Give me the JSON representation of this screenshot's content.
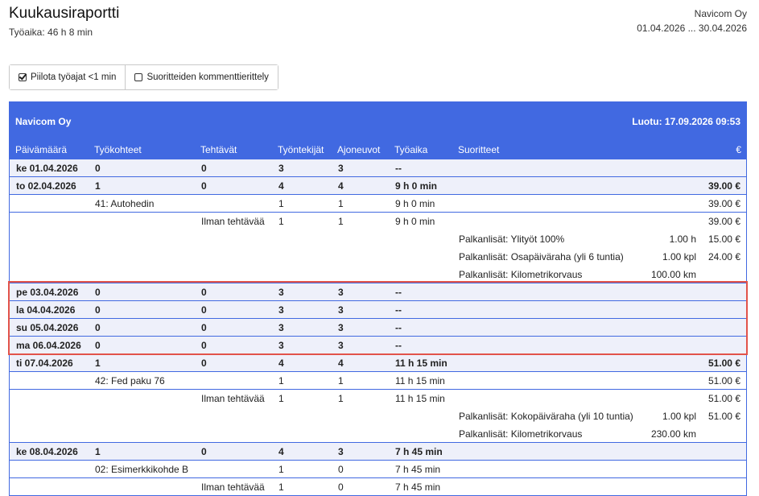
{
  "header": {
    "title": "Kuukausiraportti",
    "subtitle": "Työaika: 46 h 8 min",
    "company": "Navicom Oy",
    "date_range": "01.04.2026 ... 30.04.2026"
  },
  "toolbar": {
    "hide_short_label": "Piilota työajat <1 min",
    "hide_short_checked": true,
    "comment_rows_label": "Suoritteiden kommenttierittely",
    "comment_rows_checked": false
  },
  "report": {
    "company": "Navicom Oy",
    "created": "Luotu: 17.09.2026 09:53",
    "columns": [
      "Päivämäärä",
      "Työkohteet",
      "Tehtävät",
      "Työntekijät",
      "Ajoneuvot",
      "Työaika",
      "Suoritteet",
      "€"
    ],
    "rows": [
      {
        "kind": "day",
        "date": "ke 01.04.2026",
        "sites": "0",
        "tasks": "0",
        "employees": "3",
        "vehicles": "3",
        "time": "--",
        "perf": "",
        "qty": "",
        "eur": ""
      },
      {
        "kind": "day",
        "date": "to 02.04.2026",
        "sites": "1",
        "tasks": "0",
        "employees": "4",
        "vehicles": "4",
        "time": "9 h 0 min",
        "perf": "",
        "qty": "",
        "eur": "39.00 €"
      },
      {
        "kind": "sub",
        "date": "",
        "sites": "41: Autohedin",
        "tasks": "",
        "employees": "1",
        "vehicles": "1",
        "time": "9 h 0 min",
        "perf": "",
        "qty": "",
        "eur": "39.00 €"
      },
      {
        "kind": "sub",
        "date": "",
        "sites": "",
        "tasks": "Ilman tehtävää",
        "employees": "1",
        "vehicles": "1",
        "time": "9 h 0 min",
        "perf": "",
        "qty": "",
        "eur": "39.00 €",
        "noborder": true
      },
      {
        "kind": "sub",
        "date": "",
        "sites": "",
        "tasks": "",
        "employees": "",
        "vehicles": "",
        "time": "",
        "perf": "Palkanlisät: Ylityöt 100%",
        "qty": "1.00 h",
        "eur": "15.00 €",
        "noborder": true
      },
      {
        "kind": "sub",
        "date": "",
        "sites": "",
        "tasks": "",
        "employees": "",
        "vehicles": "",
        "time": "",
        "perf": "Palkanlisät: Osapäiväraha (yli 6 tuntia)",
        "qty": "1.00 kpl",
        "eur": "24.00 €",
        "noborder": true
      },
      {
        "kind": "sub",
        "date": "",
        "sites": "",
        "tasks": "",
        "employees": "",
        "vehicles": "",
        "time": "",
        "perf": "Palkanlisät: Kilometrikorvaus",
        "qty": "100.00 km",
        "eur": ""
      },
      {
        "kind": "day",
        "date": "pe 03.04.2026",
        "sites": "0",
        "tasks": "0",
        "employees": "3",
        "vehicles": "3",
        "time": "--",
        "perf": "",
        "qty": "",
        "eur": ""
      },
      {
        "kind": "day",
        "date": "la 04.04.2026",
        "sites": "0",
        "tasks": "0",
        "employees": "3",
        "vehicles": "3",
        "time": "--",
        "perf": "",
        "qty": "",
        "eur": ""
      },
      {
        "kind": "day",
        "date": "su 05.04.2026",
        "sites": "0",
        "tasks": "0",
        "employees": "3",
        "vehicles": "3",
        "time": "--",
        "perf": "",
        "qty": "",
        "eur": ""
      },
      {
        "kind": "day",
        "date": "ma 06.04.2026",
        "sites": "0",
        "tasks": "0",
        "employees": "3",
        "vehicles": "3",
        "time": "--",
        "perf": "",
        "qty": "",
        "eur": ""
      },
      {
        "kind": "day",
        "date": "ti 07.04.2026",
        "sites": "1",
        "tasks": "0",
        "employees": "4",
        "vehicles": "4",
        "time": "11 h 15 min",
        "perf": "",
        "qty": "",
        "eur": "51.00 €"
      },
      {
        "kind": "sub",
        "date": "",
        "sites": "42: Fed paku 76",
        "tasks": "",
        "employees": "1",
        "vehicles": "1",
        "time": "11 h 15 min",
        "perf": "",
        "qty": "",
        "eur": "51.00 €"
      },
      {
        "kind": "sub",
        "date": "",
        "sites": "",
        "tasks": "Ilman tehtävää",
        "employees": "1",
        "vehicles": "1",
        "time": "11 h 15 min",
        "perf": "",
        "qty": "",
        "eur": "51.00 €",
        "noborder": true
      },
      {
        "kind": "sub",
        "date": "",
        "sites": "",
        "tasks": "",
        "employees": "",
        "vehicles": "",
        "time": "",
        "perf": "Palkanlisät: Kokopäiväraha (yli 10 tuntia)",
        "qty": "1.00 kpl",
        "eur": "51.00 €",
        "noborder": true
      },
      {
        "kind": "sub",
        "date": "",
        "sites": "",
        "tasks": "",
        "employees": "",
        "vehicles": "",
        "time": "",
        "perf": "Palkanlisät: Kilometrikorvaus",
        "qty": "230.00 km",
        "eur": ""
      },
      {
        "kind": "day",
        "date": "ke 08.04.2026",
        "sites": "1",
        "tasks": "0",
        "employees": "4",
        "vehicles": "3",
        "time": "7 h 45 min",
        "perf": "",
        "qty": "",
        "eur": ""
      },
      {
        "kind": "sub",
        "date": "",
        "sites": "02: Esimerkkikohde B",
        "tasks": "",
        "employees": "1",
        "vehicles": "0",
        "time": "7 h 45 min",
        "perf": "",
        "qty": "",
        "eur": ""
      },
      {
        "kind": "sub",
        "date": "",
        "sites": "",
        "tasks": "Ilman tehtävää",
        "employees": "1",
        "vehicles": "0",
        "time": "7 h 45 min",
        "perf": "",
        "qty": "",
        "eur": ""
      }
    ]
  }
}
